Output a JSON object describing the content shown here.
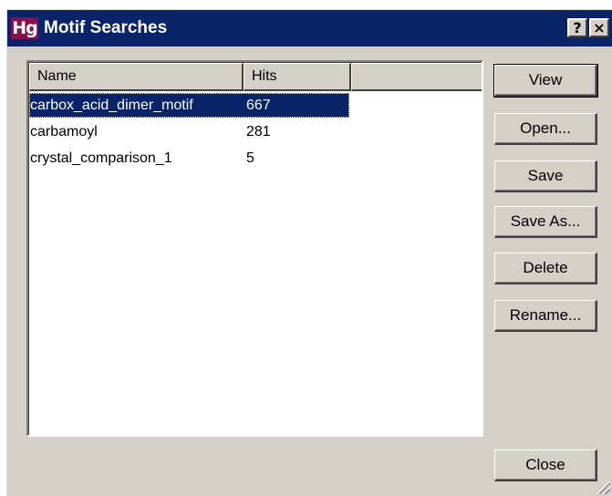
{
  "window": {
    "title": "Motif Searches",
    "app_icon_text": "Hg",
    "help_label": "?",
    "close_label": "×"
  },
  "list": {
    "columns": [
      "Name",
      "Hits",
      ""
    ],
    "rows": [
      {
        "name": "carbox_acid_dimer_motif",
        "hits": "667",
        "selected": true
      },
      {
        "name": "carbamoyl",
        "hits": "281",
        "selected": false
      },
      {
        "name": "crystal_comparison_1",
        "hits": "5",
        "selected": false
      }
    ]
  },
  "buttons": {
    "view": "View",
    "open": "Open...",
    "save": "Save",
    "save_as": "Save As...",
    "delete": "Delete",
    "rename": "Rename...",
    "close": "Close"
  },
  "colors": {
    "titlebar": "#0a246a",
    "selection": "#0a246a",
    "face": "#d4d0c8"
  }
}
